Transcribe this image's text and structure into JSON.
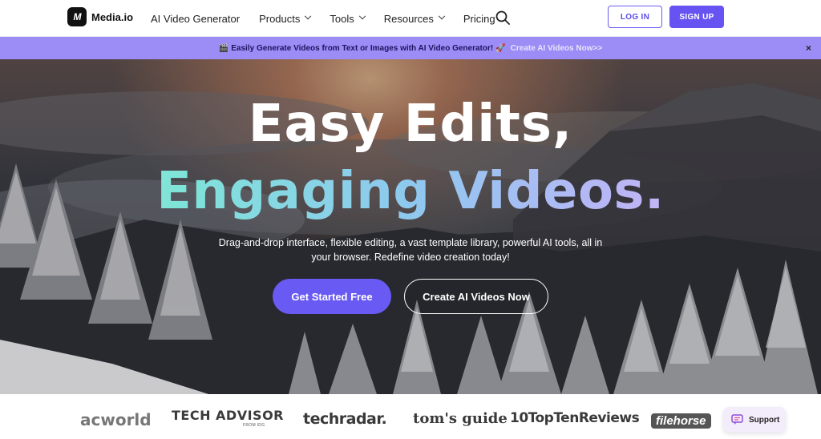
{
  "brand": {
    "logo_mark": "M",
    "name": "Media.io"
  },
  "nav": {
    "items": [
      {
        "label": "AI Video Generator",
        "dropdown": false
      },
      {
        "label": "Products",
        "dropdown": true
      },
      {
        "label": "Tools",
        "dropdown": true
      },
      {
        "label": "Resources",
        "dropdown": true
      },
      {
        "label": "Pricing",
        "dropdown": false
      }
    ],
    "search_icon": "search-icon"
  },
  "auth": {
    "login_label": "LOG IN",
    "signup_label": "SIGN UP"
  },
  "banner": {
    "emoji_left": "🎬",
    "text": "Easily Generate Videos from Text or Images with AI Video Generator!",
    "emoji_right": "🚀",
    "cta": "Create AI Videos Now>>",
    "close": "×"
  },
  "hero": {
    "title_line1": "Easy Edits,",
    "title_line2": "Engaging Videos.",
    "subtitle": "Drag-and-drop interface, flexible editing, a vast template library, powerful AI tools, all in your browser. Redefine video creation today!",
    "primary_cta": "Get Started Free",
    "secondary_cta": "Create AI Videos Now"
  },
  "press": {
    "macworld": "acworld",
    "techadvisor": "TECH ADVISOR",
    "techadvisor_sub": "FROM IDG",
    "techradar": "techradar.",
    "tomsguide": "tom's guide",
    "toptenreviews": "10TopTenReviews",
    "filehorse": "filehorse"
  },
  "support": {
    "label": "Support"
  },
  "colors": {
    "accent": "#6653f2",
    "banner": "#9b8cf6"
  }
}
